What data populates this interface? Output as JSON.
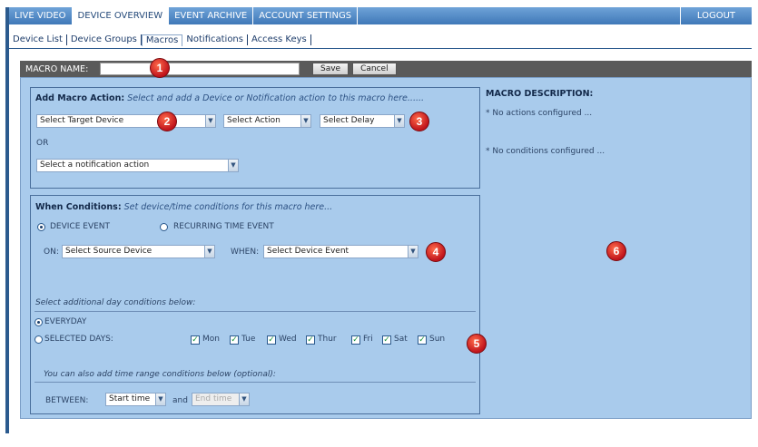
{
  "topnav": {
    "tabs": [
      "LIVE VIDEO",
      "DEVICE OVERVIEW",
      "EVENT ARCHIVE",
      "ACCOUNT SETTINGS"
    ],
    "logout": "LOGOUT"
  },
  "subnav": [
    "Device List",
    "Device Groups",
    "Macros",
    "Notifications",
    "Access Keys"
  ],
  "macro_bar": {
    "label": "MACRO NAME:",
    "name_value": "",
    "save": "Save",
    "cancel": "Cancel"
  },
  "add_action": {
    "title": "Add Macro Action:",
    "hint": "Select and add a Device or Notification action to this macro here......",
    "target_device": "Select Target Device",
    "action": "Select Action",
    "delay": "Select Delay",
    "or": "OR",
    "notification": "Select a notification action"
  },
  "conditions": {
    "title": "When Conditions:",
    "hint": "Set device/time conditions for this macro here...",
    "device_event": "DEVICE EVENT",
    "recurring": "RECURRING TIME EVENT",
    "on_label": "ON:",
    "source_device": "Select Source Device",
    "when_label": "WHEN:",
    "device_event_select": "Select Device Event",
    "day_hint": "Select additional day conditions below:",
    "everyday": "EVERYDAY",
    "selected_days": "SELECTED DAYS:",
    "days": [
      "Mon",
      "Tue",
      "Wed",
      "Thur",
      "Fri",
      "Sat",
      "Sun"
    ],
    "time_hint": "You can also add time range conditions below (optional):",
    "between": "BETWEEN:",
    "start_time": "Start time",
    "and": "and",
    "end_time": "End time"
  },
  "description": {
    "title": "MACRO DESCRIPTION:",
    "actions": "* No actions configured ...",
    "conditions": "* No conditions configured ..."
  },
  "badges": [
    "1",
    "2",
    "3",
    "4",
    "5",
    "6"
  ],
  "colors": {
    "nav": "#3f78b8",
    "panel": "#a9cbec",
    "badge": "#c0141c",
    "bar": "#5a5a5a"
  }
}
